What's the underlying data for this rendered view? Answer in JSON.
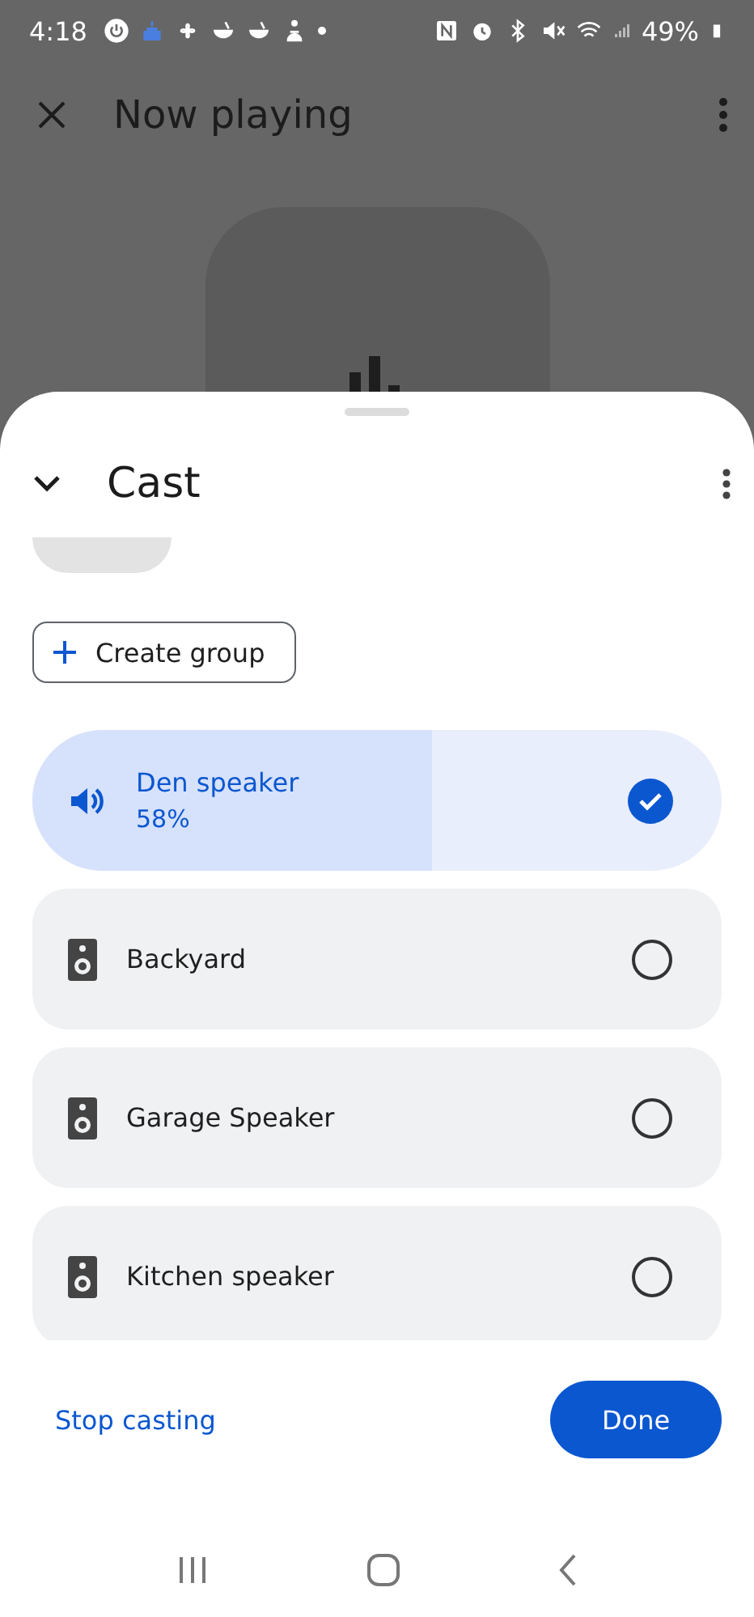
{
  "status_bar": {
    "time": "4:18",
    "battery": "49%"
  },
  "now_playing": {
    "title": "Now playing"
  },
  "sheet": {
    "title": "Cast",
    "create_group": "Create group",
    "devices": [
      {
        "name": "Den speaker",
        "reading": "58%",
        "level": 0.58,
        "selected": true
      },
      {
        "name": "Backyard",
        "selected": false
      },
      {
        "name": "Garage Speaker",
        "selected": false
      },
      {
        "name": "Kitchen speaker",
        "selected": false
      }
    ],
    "stop_button": "Stop casting",
    "done_button": "Done"
  }
}
